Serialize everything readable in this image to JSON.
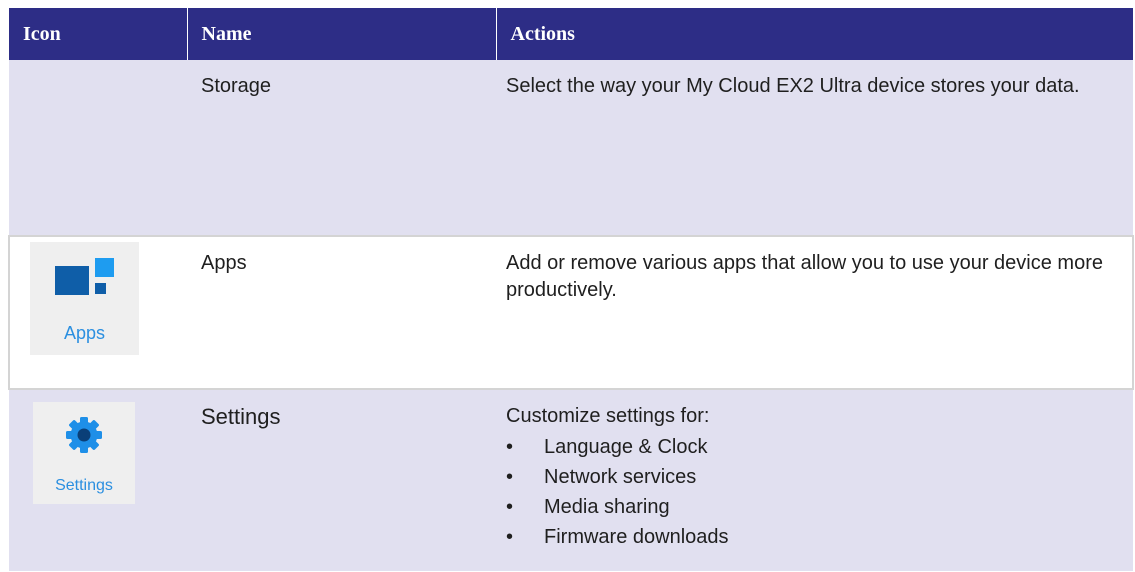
{
  "table": {
    "headers": {
      "icon": "Icon",
      "name": "Name",
      "actions": "Actions"
    },
    "rows": [
      {
        "name": "Storage",
        "action": "Select the way your My Cloud EX2 Ultra device stores your data."
      },
      {
        "icon_label": "Apps",
        "icon": "apps-icon",
        "name": "Apps",
        "action": "Add or remove various apps that allow you to use your device more productively."
      },
      {
        "icon_label": "Settings",
        "icon": "gear-icon",
        "name": "Settings",
        "action": "Customize settings for:",
        "bullets": [
          "Language & Clock",
          "Network services",
          "Media sharing",
          "Firmware downloads"
        ]
      }
    ]
  },
  "bullet_char": "•",
  "colors": {
    "header_bg": "#2d2d86",
    "shaded_row": "#e1e0f0",
    "icon_dark_blue": "#0f5ea8",
    "icon_light_blue": "#1e9cf0",
    "icon_label": "#2b8fe0"
  }
}
